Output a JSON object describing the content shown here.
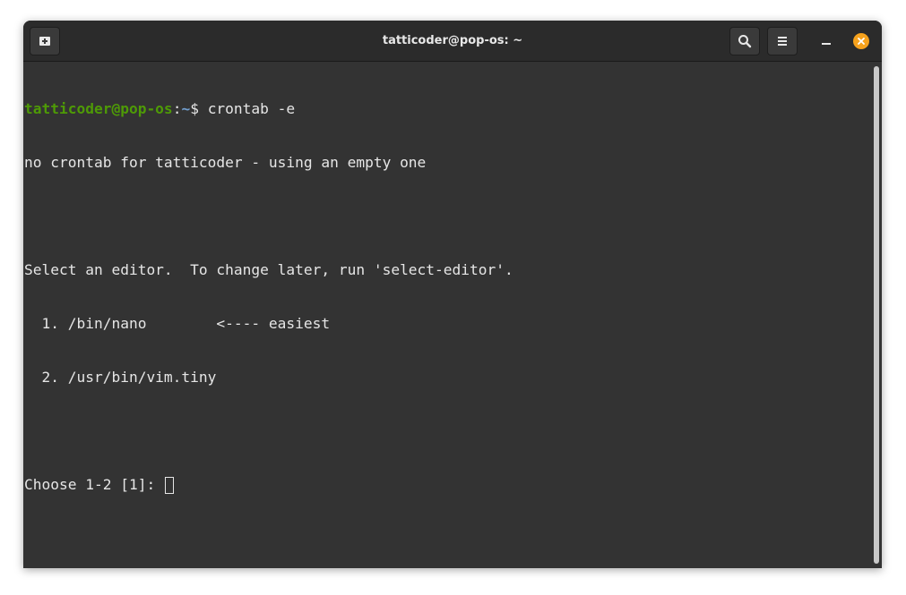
{
  "window": {
    "title": "tatticoder@pop-os: ~"
  },
  "header": {
    "new_tab_icon": "new-tab-icon",
    "search_icon": "search-icon",
    "menu_icon": "hamburger-menu-icon",
    "minimize_icon": "minimize-icon",
    "close_icon": "close-icon",
    "close_color": "#f6a21d"
  },
  "terminal": {
    "prompt": {
      "user_host": "tatticoder@pop-os",
      "separator": ":",
      "path": "~",
      "symbol": "$ ",
      "command": "crontab -e"
    },
    "lines": [
      "no crontab for tatticoder - using an empty one",
      "",
      "Select an editor.  To change later, run 'select-editor'.",
      "  1. /bin/nano        <---- easiest",
      "  2. /usr/bin/vim.tiny",
      ""
    ],
    "input_prompt": "Choose 1-2 [1]: ",
    "colors": {
      "background": "#333333",
      "text": "#e6e6e6",
      "user_host": "#4e9a06",
      "path": "#729fcf"
    }
  }
}
